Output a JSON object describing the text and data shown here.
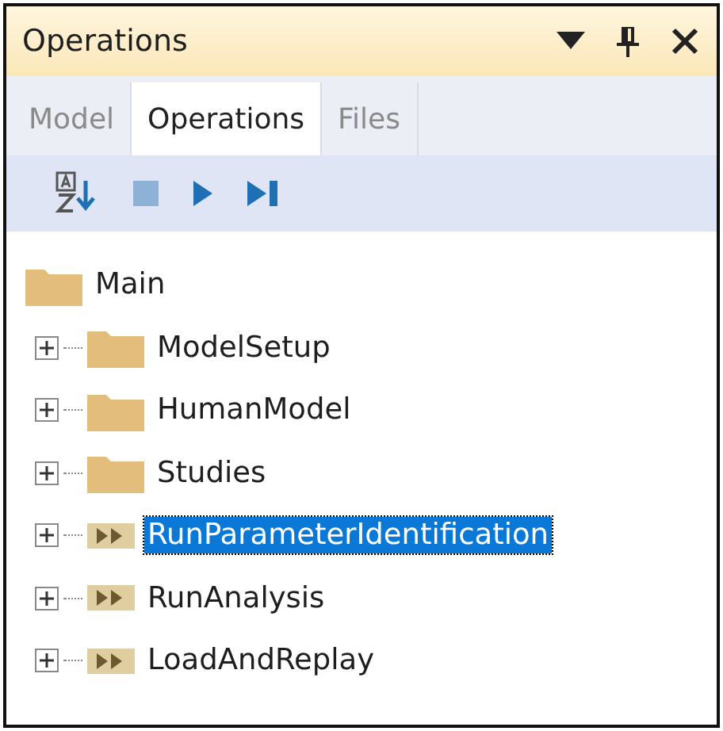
{
  "window": {
    "title": "Operations"
  },
  "tabs": [
    {
      "label": "Model",
      "selected": false
    },
    {
      "label": "Operations",
      "selected": true
    },
    {
      "label": "Files",
      "selected": false
    }
  ],
  "tree": [
    {
      "label": "Main",
      "kind": "folder",
      "selected": false,
      "children": [
        {
          "label": "ModelSetup",
          "kind": "folder",
          "selected": false,
          "expanded": false
        },
        {
          "label": "HumanModel",
          "kind": "folder",
          "selected": false,
          "expanded": false
        },
        {
          "label": "Studies",
          "kind": "folder",
          "selected": false,
          "expanded": false
        },
        {
          "label": "RunParameterIdentification",
          "kind": "operation",
          "selected": true,
          "expanded": false
        },
        {
          "label": "RunAnalysis",
          "kind": "operation",
          "selected": false,
          "expanded": false
        },
        {
          "label": "LoadAndReplay",
          "kind": "operation",
          "selected": false,
          "expanded": false
        }
      ]
    }
  ]
}
